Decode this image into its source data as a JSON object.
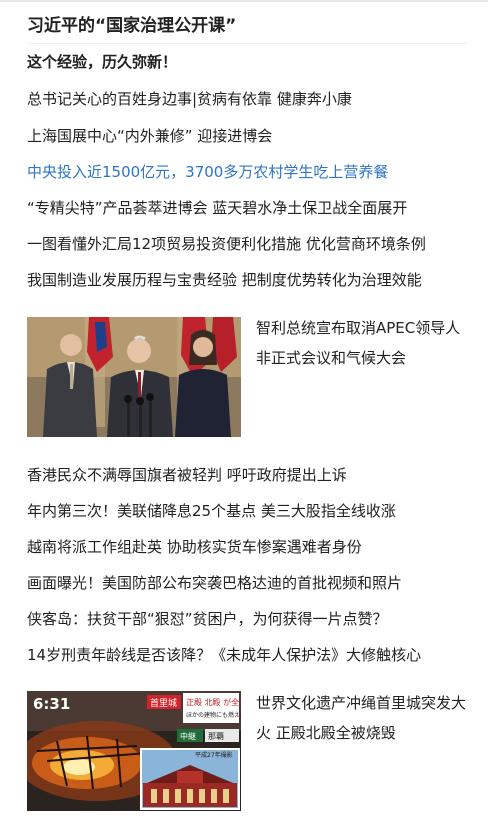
{
  "section_title": "习近平的“国家治理公开课”",
  "headlines_top": [
    "这个经验，历久弥新！",
    "总书记关心的百姓身边事|贫病有依靠 健康奔小康",
    "上海国展中心“内外兼修” 迎接进博会",
    "中央投入近1500亿元，3700多万农村学生吃上营养餐",
    "“专精尖特”产品荟萃进博会 蓝天碧水净土保卫战全面展开",
    "一图看懂外汇局12项贸易投资便利化措施 优化营商环境条例",
    "我国制造业发展历程与宝贵经验 把制度优势转化为治理效能"
  ],
  "feature_1": {
    "caption": "智利总统宣布取消APEC领导人非正式会议和气候大会"
  },
  "headlines_mid": [
    "香港民众不满辱国旗者被轻判 呼吁政府提出上诉",
    "年内第三次！美联储降息25个基点 美三大股指全线收涨",
    "越南将派工作组赴英 协助核实货车惨案遇难者身份",
    "画面曝光！美国防部公布突袭巴格达迪的首批视频和照片",
    "侠客岛：扶贫干部“狠怼”贫困户，为何获得一片点赞？",
    "14岁刑责年龄线是否该降？《未成年人保护法》大修触核心"
  ],
  "feature_2": {
    "caption": "世界文化遗产冲绳首里城突发大火 正殿北殿全被烧毁",
    "overlay_time": "6:31",
    "overlay_tag": "首里城",
    "overlay_banner": "正殿 北殿 が全焼",
    "overlay_sub": "ほかの建物にも燃え広がる",
    "overlay_place": "那覇",
    "overlay_footer": "平成27年撮影",
    "overlay_channel": "中継"
  },
  "colors": {
    "link": "#222222",
    "highlight": "#2e74c7"
  }
}
